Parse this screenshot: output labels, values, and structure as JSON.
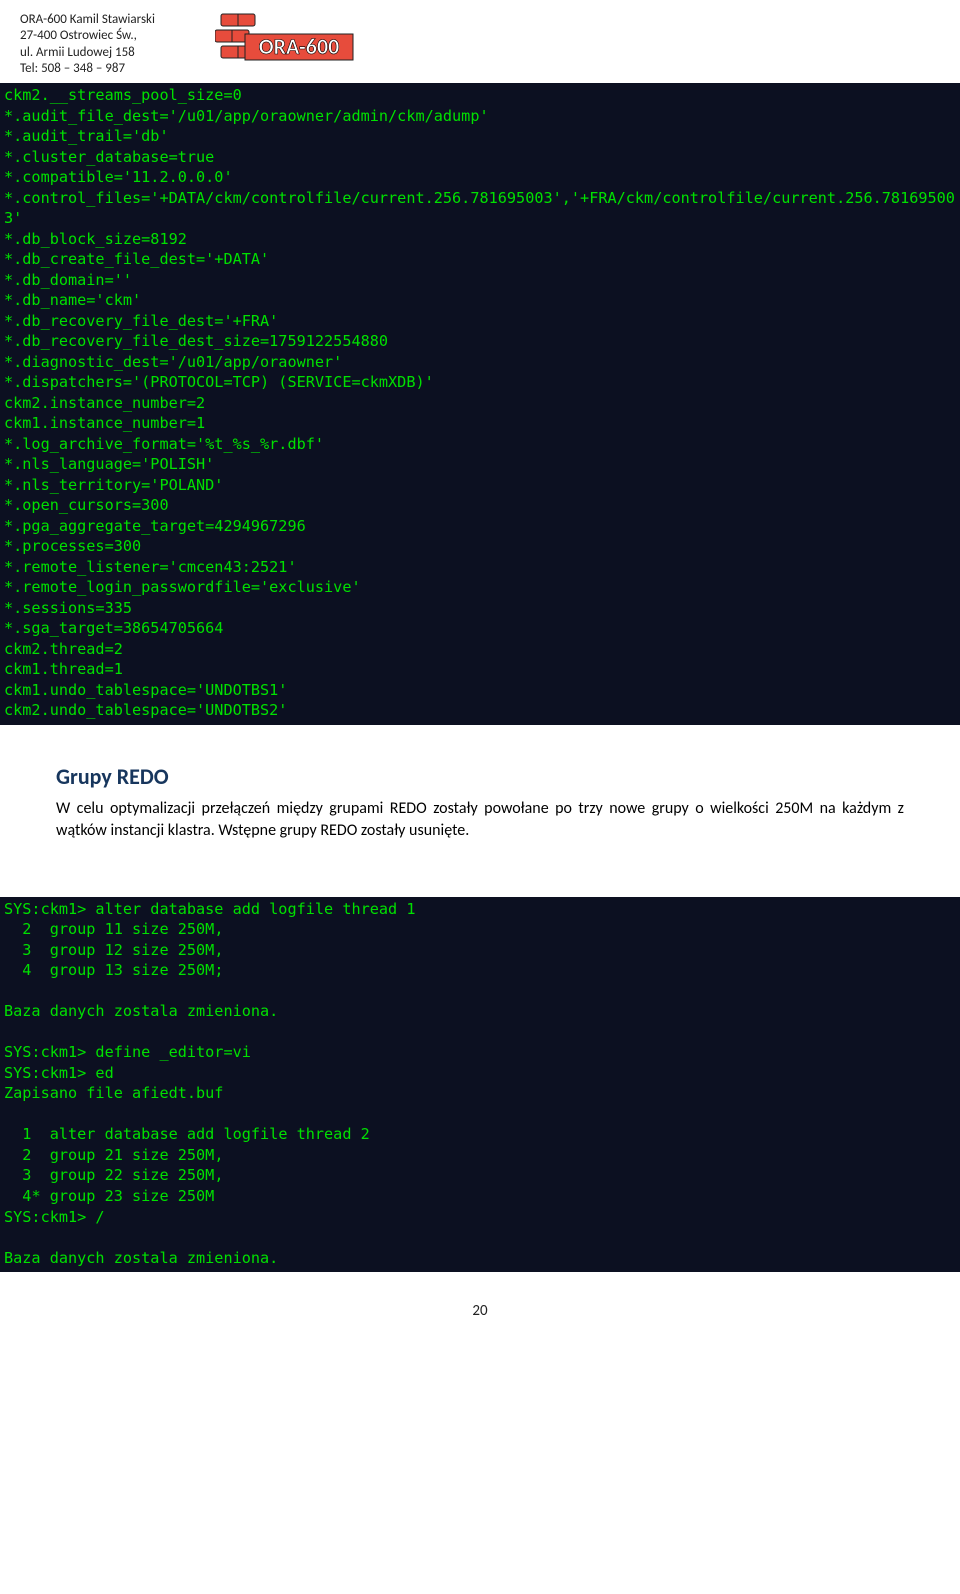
{
  "header": {
    "line1": "ORA-600 Kamil Stawiarski",
    "line2": "27-400 Ostrowiec Św.,",
    "line3": "ul. Armii Ludowej 158",
    "tel_label": "Tel:",
    "tel_value": " 508 – 348 – 987",
    "logo_text": "ORA-600"
  },
  "terminal1": [
    "ckm2.__streams_pool_size=0",
    "*.audit_file_dest='/u01/app/oraowner/admin/ckm/adump'",
    "*.audit_trail='db'",
    "*.cluster_database=true",
    "*.compatible='11.2.0.0.0'",
    "*.control_files='+DATA/ckm/controlfile/current.256.781695003','+FRA/ckm/controlfile/current.256.781695003'",
    "*.db_block_size=8192",
    "*.db_create_file_dest='+DATA'",
    "*.db_domain=''",
    "*.db_name='ckm'",
    "*.db_recovery_file_dest='+FRA'",
    "*.db_recovery_file_dest_size=1759122554880",
    "*.diagnostic_dest='/u01/app/oraowner'",
    "*.dispatchers='(PROTOCOL=TCP) (SERVICE=ckmXDB)'",
    "ckm2.instance_number=2",
    "ckm1.instance_number=1",
    "*.log_archive_format='%t_%s_%r.dbf'",
    "*.nls_language='POLISH'",
    "*.nls_territory='POLAND'",
    "*.open_cursors=300",
    "*.pga_aggregate_target=4294967296",
    "*.processes=300",
    "*.remote_listener='cmcen43:2521'",
    "*.remote_login_passwordfile='exclusive'",
    "*.sessions=335",
    "*.sga_target=38654705664",
    "ckm2.thread=2",
    "ckm1.thread=1",
    "ckm1.undo_tablespace='UNDOTBS1'",
    "ckm2.undo_tablespace='UNDOTBS2'"
  ],
  "section_title": "Grupy REDO",
  "section_body": "W celu optymalizacji przełączeń między grupami REDO zostały powołane po trzy nowe grupy o wielkości 250M na każdym z wątków instancji klastra. Wstępne grupy REDO zostały usunięte.",
  "terminal2": [
    "SYS:ckm1> alter database add logfile thread 1",
    "  2  group 11 size 250M,",
    "  3  group 12 size 250M,",
    "  4  group 13 size 250M;",
    "",
    "Baza danych zostala zmieniona.",
    "",
    "SYS:ckm1> define _editor=vi",
    "SYS:ckm1> ed",
    "Zapisano file afiedt.buf",
    "",
    "  1  alter database add logfile thread 2",
    "  2  group 21 size 250M,",
    "  3  group 22 size 250M,",
    "  4* group 23 size 250M",
    "SYS:ckm1> /",
    "",
    "Baza danych zostala zmieniona."
  ],
  "page_number": "20"
}
